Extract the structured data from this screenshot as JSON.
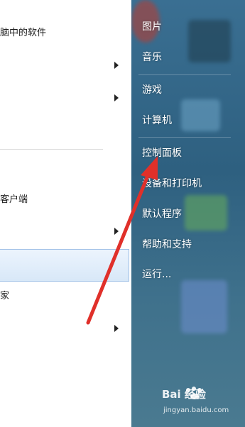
{
  "left_menu": {
    "items": [
      {
        "label": "脑中的软件"
      },
      {
        "label": "客户端"
      },
      {
        "label": "家"
      }
    ]
  },
  "right_menu": {
    "items": [
      {
        "label": "图片"
      },
      {
        "label": "音乐"
      },
      {
        "label": "游戏"
      },
      {
        "label": "计算机"
      },
      {
        "label": "控制面板"
      },
      {
        "label": "设备和打印机"
      },
      {
        "label": "默认程序"
      },
      {
        "label": "帮助和支持"
      },
      {
        "label": "运行..."
      }
    ]
  },
  "watermark": {
    "logo": "Bai  经验",
    "url": "jingyan.baidu.com"
  },
  "colors": {
    "annotation_arrow": "#e0302a",
    "right_pane": "#2e6080"
  }
}
